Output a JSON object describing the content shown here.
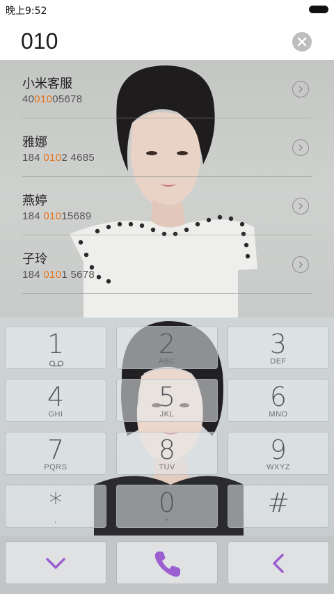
{
  "status_bar": {
    "time": "晚上9:52"
  },
  "search": {
    "query": "010"
  },
  "results": [
    {
      "name": "小米客服",
      "number_pre": "40",
      "number_match": "010",
      "number_post": "05678"
    },
    {
      "name": "雅娜",
      "number_pre": "184 ",
      "number_match": "010",
      "number_post": "2 4685"
    },
    {
      "name": "燕婷",
      "number_pre": "184 ",
      "number_match": "010",
      "number_post": "15689"
    },
    {
      "name": "子玲",
      "number_pre": "184 ",
      "number_match": "010",
      "number_post": "1 5678"
    }
  ],
  "keypad": {
    "keys": [
      {
        "digit": "1",
        "letters": ""
      },
      {
        "digit": "2",
        "letters": "ABC"
      },
      {
        "digit": "3",
        "letters": "DEF"
      },
      {
        "digit": "4",
        "letters": "GHI"
      },
      {
        "digit": "5",
        "letters": "JKL"
      },
      {
        "digit": "6",
        "letters": "MNO"
      },
      {
        "digit": "7",
        "letters": "PQRS"
      },
      {
        "digit": "8",
        "letters": "TUV"
      },
      {
        "digit": "9",
        "letters": "WXYZ"
      },
      {
        "digit": "*",
        "letters": ","
      },
      {
        "digit": "0",
        "letters": "+"
      },
      {
        "digit": "#",
        "letters": ""
      }
    ]
  },
  "actions": {
    "collapse_icon": "chevron-down-icon",
    "call_icon": "phone-icon",
    "backspace_icon": "chevron-left-icon",
    "accent_color": "#9b5fd0"
  },
  "colors": {
    "highlight": "#e8741c"
  }
}
